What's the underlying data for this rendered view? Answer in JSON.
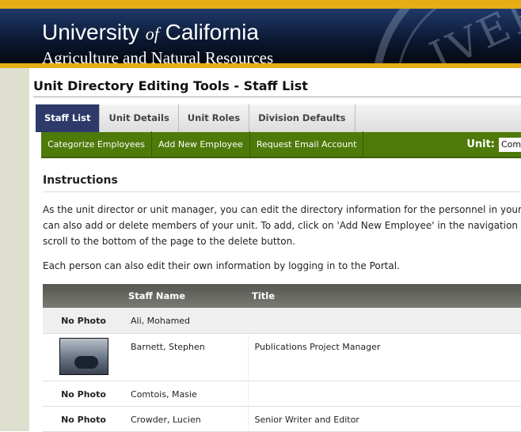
{
  "header": {
    "univ_a": "University",
    "univ_of": "of",
    "univ_b": "California",
    "division": "Agriculture and Natural Resources",
    "seal_text": "IVER"
  },
  "page_title": "Unit Directory Editing Tools - Staff List",
  "tabs": [
    {
      "label": "Staff List",
      "active": true
    },
    {
      "label": "Unit Details"
    },
    {
      "label": "Unit Roles"
    },
    {
      "label": "Division Defaults"
    }
  ],
  "subnav": {
    "items": [
      "Categorize Employees",
      "Add New Employee",
      "Request Email Account"
    ],
    "unit_label": "Unit:",
    "unit_value": "Communications"
  },
  "instructions": {
    "heading": "Instructions",
    "lines": [
      "As the unit director or unit manager, you can edit the directory information for the personnel in your",
      "can also add or delete members of your unit. To add, click on 'Add New Employee' in the navigation",
      "scroll to the bottom of the page to the delete button."
    ],
    "note": "Each person can also edit their own information by logging in to the Portal."
  },
  "table": {
    "headers": [
      "",
      "Staff Name",
      "Title"
    ],
    "rows": [
      {
        "photo": "No Photo",
        "name": "Ali, Mohamed",
        "title": ""
      },
      {
        "photo": "",
        "name": "Barnett, Stephen",
        "title": "Publications Project Manager"
      },
      {
        "photo": "No Photo",
        "name": "Comtois, Masie",
        "title": ""
      },
      {
        "photo": "No Photo",
        "name": "Crowder, Lucien",
        "title": "Senior Writer and Editor"
      }
    ]
  }
}
